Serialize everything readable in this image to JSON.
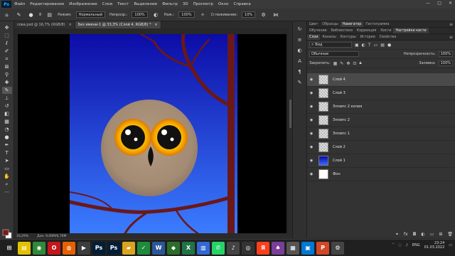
{
  "menu": {
    "logo": "Ps",
    "items": [
      "Файл",
      "Редактирование",
      "Изображение",
      "Слои",
      "Текст",
      "Выделение",
      "Фильтр",
      "3D",
      "Просмотр",
      "Окно",
      "Справка"
    ],
    "window_controls": [
      "—",
      "□",
      "✕"
    ]
  },
  "options": {
    "brush_size": "8",
    "mode_label": "Режим:",
    "mode_value": "Нормальный",
    "opacity_label": "Непрозр.:",
    "opacity_value": "100%",
    "pressure_label": "Наж.:",
    "pressure_value": "100%",
    "smoothing_label": "Сглаживание:",
    "smoothing_value": "10%"
  },
  "doc_tabs": [
    {
      "title": "сова.psd @ 16,7% (RGB/8)",
      "close": "×"
    },
    {
      "title": "Без имени-1 @ 33,3% (Слой 4, RGB/8) *",
      "close": "×"
    }
  ],
  "status": {
    "zoom": "33,29%",
    "doc": "Док: 9,00M/6,76M"
  },
  "panel_top": {
    "tabs": [
      "Цвет",
      "Образцы",
      "Навигатор",
      "Гистограмма"
    ],
    "active": "Навигатор",
    "tabs2": [
      "Обучение",
      "Библиотеки",
      "Коррекция",
      "Кисти",
      "Настройки кисти"
    ],
    "active2": "Настройки кисти"
  },
  "layers_panel": {
    "tabs": [
      "Слои",
      "Каналы",
      "Контуры",
      "История",
      "Свойства"
    ],
    "active": "Слои",
    "search_value": "Вид",
    "blend_value": "Обычные",
    "opacity_label": "Непрозрачность:",
    "opacity_value": "100%",
    "lock_label": "Закрепить:",
    "fill_label": "Заливка:",
    "fill_value": "100%",
    "layers": [
      {
        "name": "Слой 4",
        "thumb": "checker",
        "selected": true
      },
      {
        "name": "Слой 3",
        "thumb": "checker",
        "selected": false
      },
      {
        "name": "Эллипс 2 копия",
        "thumb": "checker",
        "selected": false
      },
      {
        "name": "Эллипс 2",
        "thumb": "checker",
        "selected": false
      },
      {
        "name": "Эллипс 1",
        "thumb": "checker",
        "selected": false
      },
      {
        "name": "Слой 2",
        "thumb": "checker",
        "selected": false
      },
      {
        "name": "Слой 1",
        "thumb": "blue",
        "selected": false
      },
      {
        "name": "Фон",
        "thumb": "white",
        "selected": false
      }
    ]
  },
  "taskbar": {
    "apps": [
      {
        "icon": "windows-start-icon",
        "label": "⊞",
        "color": "#1f1f1f"
      },
      {
        "icon": "sticky-notes-icon",
        "label": "▤",
        "color": "#e2c200"
      },
      {
        "icon": "chrome-icon",
        "label": "◉",
        "color": "#2f8a3a"
      },
      {
        "icon": "opera-icon",
        "label": "O",
        "color": "#c4161c"
      },
      {
        "icon": "firefox-icon",
        "label": "◍",
        "color": "#e66000"
      },
      {
        "icon": "media-player-icon",
        "label": "▶",
        "color": "#3d3d3d"
      },
      {
        "icon": "photoshop-icon",
        "label": "Ps",
        "color": "#001e36"
      },
      {
        "icon": "photoshop-alt-icon",
        "label": "Ps",
        "color": "#001e36"
      },
      {
        "icon": "folder-icon",
        "label": "▰",
        "color": "#d9a520"
      },
      {
        "icon": "app-green-icon",
        "label": "✓",
        "color": "#1e8a3c"
      },
      {
        "icon": "word-icon",
        "label": "W",
        "color": "#2b579a"
      },
      {
        "icon": "maps-icon",
        "label": "◆",
        "color": "#2a6e2a"
      },
      {
        "icon": "excel-icon",
        "label": "X",
        "color": "#217346"
      },
      {
        "icon": "explorer-icon",
        "label": "▥",
        "color": "#3367d6"
      },
      {
        "icon": "whatsapp-icon",
        "label": "✆",
        "color": "#25d366"
      },
      {
        "icon": "audio-icon",
        "label": "♪",
        "color": "#444"
      },
      {
        "icon": "camera-icon",
        "label": "◎",
        "color": "#333"
      },
      {
        "icon": "yandex-icon",
        "label": "Я",
        "color": "#fc3f1d"
      },
      {
        "icon": "game-icon",
        "label": "♠",
        "color": "#7a3e9a"
      },
      {
        "icon": "calc-icon",
        "label": "▦",
        "color": "#555"
      },
      {
        "icon": "photos-icon",
        "label": "▣",
        "color": "#0078d4"
      },
      {
        "icon": "ppt-icon",
        "label": "P",
        "color": "#d24726"
      },
      {
        "icon": "tool-icon",
        "label": "⚙",
        "color": "#444"
      }
    ],
    "lang": "ENG",
    "time": "23:24",
    "date": "01.03.2022"
  },
  "colors": {
    "sky_top": "#0c0ca6",
    "sky_bottom": "#3b7cff",
    "branch": "#6a1818",
    "owl_body": "#a89078",
    "eye_ring": "#f2a000",
    "beak": "#111111"
  }
}
